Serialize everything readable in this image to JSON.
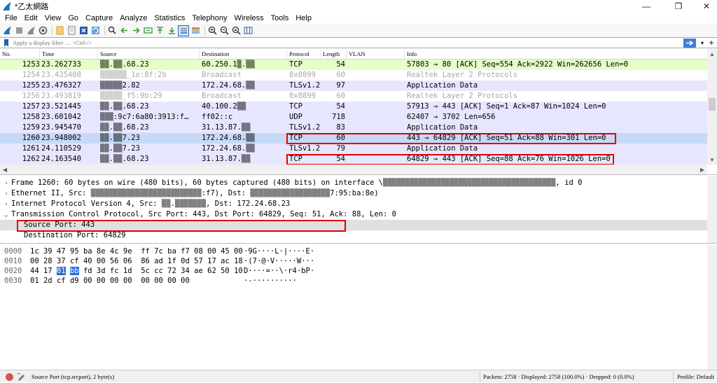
{
  "window": {
    "title": "*乙太網路",
    "minimize": "—",
    "restore": "❐",
    "close": "✕"
  },
  "menu": [
    "File",
    "Edit",
    "View",
    "Go",
    "Capture",
    "Analyze",
    "Statistics",
    "Telephony",
    "Wireless",
    "Tools",
    "Help"
  ],
  "filter": {
    "placeholder": "Apply a display filter … <Ctrl-/>",
    "apply_icon": "arrow-right-icon",
    "dropdown": "▾",
    "add": "+"
  },
  "colors": {
    "row_green": "#e4ffc7",
    "row_blue": "#e7e6ff",
    "row_gray": "#ffffff",
    "row_selected": "#c6d9f7",
    "highlight": "#e00000"
  },
  "packet_list": {
    "columns": [
      "No.",
      "Time",
      "Source",
      "Destination",
      "Protocol",
      "Length",
      "VLAN",
      "Info"
    ],
    "rows": [
      {
        "no": "1253",
        "time": "23.262733",
        "src": "▒▒.▒▒.68.23",
        "dst": "60.250.1▒.▒▒",
        "proto": "TCP",
        "len": "54",
        "vlan": "",
        "info": "57803 → 80 [ACK] Seq=554 Ack=2922 Win=262656 Len=0",
        "style": "green"
      },
      {
        "no": "1254",
        "time": "23.435408",
        "src": "▒▒▒▒▒▒_1e:8f:2b",
        "dst": "Broadcast",
        "proto": "0x8899",
        "len": "60",
        "vlan": "",
        "info": "Realtek Layer 2 Protocols",
        "style": "gray"
      },
      {
        "no": "1255",
        "time": "23.476327",
        "src": "▒▒▒▒▒2.82",
        "dst": "172.24.68.▒▒",
        "proto": "TLSv1.2",
        "len": "97",
        "vlan": "",
        "info": "Application Data",
        "style": "blue"
      },
      {
        "no": "1256",
        "time": "23.493819",
        "src": "▒▒▒▒▒_f5:9b:29",
        "dst": "Broadcast",
        "proto": "0x8899",
        "len": "60",
        "vlan": "",
        "info": "Realtek Layer 2 Protocols",
        "style": "gray"
      },
      {
        "no": "1257",
        "time": "23.521445",
        "src": "▒▒.▒▒.68.23",
        "dst": "40.100.2▒▒",
        "proto": "TCP",
        "len": "54",
        "vlan": "",
        "info": "57913 → 443 [ACK] Seq=1 Ack=87 Win=1024 Len=0",
        "style": "blue"
      },
      {
        "no": "1258",
        "time": "23.601042",
        "src": "▒▒▒:9c7:6a80:3913:f…",
        "dst": "ff02::c",
        "proto": "UDP",
        "len": "718",
        "vlan": "",
        "info": "62407 → 3702 Len=656",
        "style": "blue"
      },
      {
        "no": "1259",
        "time": "23.945470",
        "src": "▒▒.▒▒.68.23",
        "dst": "31.13.87.▒▒",
        "proto": "TLSv1.2",
        "len": "83",
        "vlan": "",
        "info": "Application Data",
        "style": "blue"
      },
      {
        "no": "1260",
        "time": "23.948002",
        "src": "▒▒.▒▒7.23",
        "dst": "172.24.68.▒▒",
        "proto": "TCP",
        "len": "60",
        "vlan": "",
        "info": "443 → 64829 [ACK] Seq=51 Ack=88 Win=301 Len=0",
        "style": "selected"
      },
      {
        "no": "1261",
        "time": "24.110529",
        "src": "▒▒.▒▒7.23",
        "dst": "172.24.68.▒▒",
        "proto": "TLSv1.2",
        "len": "79",
        "vlan": "",
        "info": "Application Data",
        "style": "blue"
      },
      {
        "no": "1262",
        "time": "24.163540",
        "src": "▒▒.▒▒.68.23",
        "dst": "31.13.87.▒▒",
        "proto": "TCP",
        "len": "54",
        "vlan": "",
        "info": "64829 → 443 [ACK] Seq=88 Ack=76 Win=1026 Len=0",
        "style": "blue"
      }
    ]
  },
  "details": [
    {
      "toggle": "›",
      "text": "Frame 1260: 60 bytes on wire (480 bits), 60 bytes captured (480 bits) on interface \\▒▒▒▒▒▒▒▒▒▒▒▒▒▒▒▒▒▒▒▒▒▒▒▒▒▒▒▒▒▒▒▒▒▒▒▒▒▒▒, id 0"
    },
    {
      "toggle": "›",
      "text": "Ethernet II, Src: ▒▒▒▒▒▒▒▒▒▒▒▒▒▒▒▒▒▒▒▒▒▒▒▒▒:f7), Dst: ▒▒▒▒▒▒▒▒▒▒▒▒▒▒▒▒▒▒7:95:ba:8e)"
    },
    {
      "toggle": "›",
      "text": "Internet Protocol Version 4, Src: ▒▒.▒▒▒▒▒▒▒, Dst: 172.24.68.23"
    },
    {
      "toggle": "⌄",
      "text": "Transmission Control Protocol, Src Port: 443, Dst Port: 64829, Seq: 51, Ack: 88, Len: 0"
    },
    {
      "toggle": "",
      "text": "Source Port: 443",
      "indent": true,
      "selected": true
    },
    {
      "toggle": "",
      "text": "Destination Port: 64829",
      "indent": true
    }
  ],
  "bytes": [
    {
      "off": "0000",
      "hex": [
        "1c",
        "39",
        "47",
        "95",
        "ba",
        "8e",
        "4c",
        "9e",
        "ff",
        "7c",
        "ba",
        "f7",
        "08",
        "00",
        "45",
        "00"
      ],
      "ascii": "·9G····L·|····E·"
    },
    {
      "off": "0010",
      "hex": [
        "00",
        "28",
        "37",
        "cf",
        "40",
        "00",
        "56",
        "06",
        "86",
        "ad",
        "1f",
        "0d",
        "57",
        "17",
        "ac",
        "18"
      ],
      "ascii": "·(7·@·V·····W···"
    },
    {
      "off": "0020",
      "hex": [
        "44",
        "17",
        "01",
        "bb",
        "fd",
        "3d",
        "fc",
        "1d",
        "5c",
        "cc",
        "72",
        "34",
        "ae",
        "62",
        "50",
        "10"
      ],
      "ascii": "D····=··\\·r4·bP·"
    },
    {
      "off": "0030",
      "hex": [
        "01",
        "2d",
        "cf",
        "d9",
        "00",
        "00",
        "00",
        "00",
        "00",
        "00",
        "00",
        "00"
      ],
      "ascii": "·-··········"
    }
  ],
  "status": {
    "field": "Source Port (tcp.srcport), 2 byte(s)",
    "packets": "Packets: 2758 · Displayed: 2758 (100.0%) · Dropped: 0 (0.0%)",
    "profile": "Profile: Default"
  }
}
